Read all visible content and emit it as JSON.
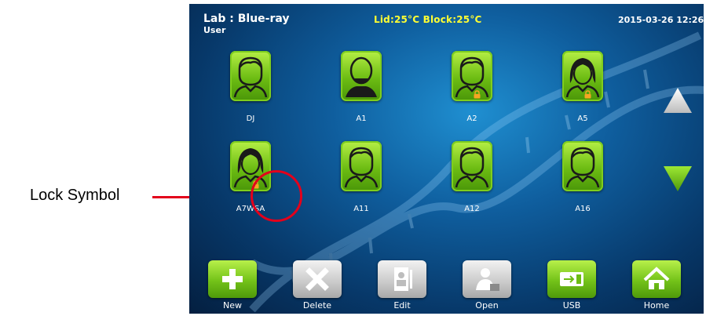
{
  "callout": {
    "label": "Lock Symbol"
  },
  "header": {
    "lab": "Lab : Blue-ray",
    "user": "User",
    "temps": "Lid:25°C   Block:25°C",
    "datetime": "2015-03-26 12:26"
  },
  "users": [
    {
      "name": "DJ",
      "avatar": "male-icon",
      "locked": false
    },
    {
      "name": "A1",
      "avatar": "bald-bearded-icon",
      "locked": false
    },
    {
      "name": "A2",
      "avatar": "male-icon",
      "locked": true
    },
    {
      "name": "A5",
      "avatar": "female-icon",
      "locked": true
    },
    {
      "name": "A7WSA",
      "avatar": "female-icon",
      "locked": true
    },
    {
      "name": "A11",
      "avatar": "male-icon",
      "locked": false
    },
    {
      "name": "A12",
      "avatar": "male-icon",
      "locked": false
    },
    {
      "name": "A16",
      "avatar": "male-icon",
      "locked": false
    }
  ],
  "toolbar": {
    "new_label": "New",
    "delete_label": "Delete",
    "edit_label": "Edit",
    "open_label": "Open",
    "usb_label": "USB",
    "home_label": "Home"
  },
  "colors": {
    "accent_green": "#7fce1d",
    "temps_yellow": "#ffff33",
    "highlight_red": "#e3001b",
    "lock_orange": "#f5a623"
  }
}
